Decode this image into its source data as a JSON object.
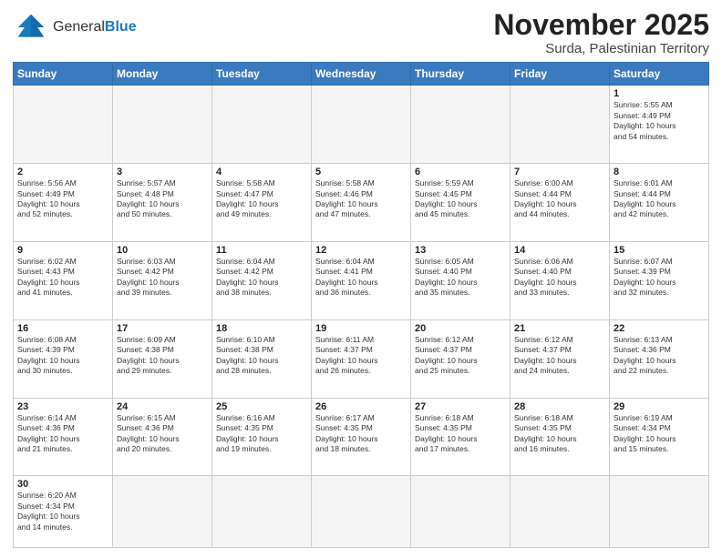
{
  "header": {
    "logo_general": "General",
    "logo_blue": "Blue",
    "month_year": "November 2025",
    "location": "Surda, Palestinian Territory"
  },
  "days_of_week": [
    "Sunday",
    "Monday",
    "Tuesday",
    "Wednesday",
    "Thursday",
    "Friday",
    "Saturday"
  ],
  "weeks": [
    [
      {
        "day": "",
        "info": ""
      },
      {
        "day": "",
        "info": ""
      },
      {
        "day": "",
        "info": ""
      },
      {
        "day": "",
        "info": ""
      },
      {
        "day": "",
        "info": ""
      },
      {
        "day": "",
        "info": ""
      },
      {
        "day": "1",
        "info": "Sunrise: 5:55 AM\nSunset: 4:49 PM\nDaylight: 10 hours\nand 54 minutes."
      }
    ],
    [
      {
        "day": "2",
        "info": "Sunrise: 5:56 AM\nSunset: 4:49 PM\nDaylight: 10 hours\nand 52 minutes."
      },
      {
        "day": "3",
        "info": "Sunrise: 5:57 AM\nSunset: 4:48 PM\nDaylight: 10 hours\nand 50 minutes."
      },
      {
        "day": "4",
        "info": "Sunrise: 5:58 AM\nSunset: 4:47 PM\nDaylight: 10 hours\nand 49 minutes."
      },
      {
        "day": "5",
        "info": "Sunrise: 5:58 AM\nSunset: 4:46 PM\nDaylight: 10 hours\nand 47 minutes."
      },
      {
        "day": "6",
        "info": "Sunrise: 5:59 AM\nSunset: 4:45 PM\nDaylight: 10 hours\nand 45 minutes."
      },
      {
        "day": "7",
        "info": "Sunrise: 6:00 AM\nSunset: 4:44 PM\nDaylight: 10 hours\nand 44 minutes."
      },
      {
        "day": "8",
        "info": "Sunrise: 6:01 AM\nSunset: 4:44 PM\nDaylight: 10 hours\nand 42 minutes."
      }
    ],
    [
      {
        "day": "9",
        "info": "Sunrise: 6:02 AM\nSunset: 4:43 PM\nDaylight: 10 hours\nand 41 minutes."
      },
      {
        "day": "10",
        "info": "Sunrise: 6:03 AM\nSunset: 4:42 PM\nDaylight: 10 hours\nand 39 minutes."
      },
      {
        "day": "11",
        "info": "Sunrise: 6:04 AM\nSunset: 4:42 PM\nDaylight: 10 hours\nand 38 minutes."
      },
      {
        "day": "12",
        "info": "Sunrise: 6:04 AM\nSunset: 4:41 PM\nDaylight: 10 hours\nand 36 minutes."
      },
      {
        "day": "13",
        "info": "Sunrise: 6:05 AM\nSunset: 4:40 PM\nDaylight: 10 hours\nand 35 minutes."
      },
      {
        "day": "14",
        "info": "Sunrise: 6:06 AM\nSunset: 4:40 PM\nDaylight: 10 hours\nand 33 minutes."
      },
      {
        "day": "15",
        "info": "Sunrise: 6:07 AM\nSunset: 4:39 PM\nDaylight: 10 hours\nand 32 minutes."
      }
    ],
    [
      {
        "day": "16",
        "info": "Sunrise: 6:08 AM\nSunset: 4:39 PM\nDaylight: 10 hours\nand 30 minutes."
      },
      {
        "day": "17",
        "info": "Sunrise: 6:09 AM\nSunset: 4:38 PM\nDaylight: 10 hours\nand 29 minutes."
      },
      {
        "day": "18",
        "info": "Sunrise: 6:10 AM\nSunset: 4:38 PM\nDaylight: 10 hours\nand 28 minutes."
      },
      {
        "day": "19",
        "info": "Sunrise: 6:11 AM\nSunset: 4:37 PM\nDaylight: 10 hours\nand 26 minutes."
      },
      {
        "day": "20",
        "info": "Sunrise: 6:12 AM\nSunset: 4:37 PM\nDaylight: 10 hours\nand 25 minutes."
      },
      {
        "day": "21",
        "info": "Sunrise: 6:12 AM\nSunset: 4:37 PM\nDaylight: 10 hours\nand 24 minutes."
      },
      {
        "day": "22",
        "info": "Sunrise: 6:13 AM\nSunset: 4:36 PM\nDaylight: 10 hours\nand 22 minutes."
      }
    ],
    [
      {
        "day": "23",
        "info": "Sunrise: 6:14 AM\nSunset: 4:36 PM\nDaylight: 10 hours\nand 21 minutes."
      },
      {
        "day": "24",
        "info": "Sunrise: 6:15 AM\nSunset: 4:36 PM\nDaylight: 10 hours\nand 20 minutes."
      },
      {
        "day": "25",
        "info": "Sunrise: 6:16 AM\nSunset: 4:35 PM\nDaylight: 10 hours\nand 19 minutes."
      },
      {
        "day": "26",
        "info": "Sunrise: 6:17 AM\nSunset: 4:35 PM\nDaylight: 10 hours\nand 18 minutes."
      },
      {
        "day": "27",
        "info": "Sunrise: 6:18 AM\nSunset: 4:35 PM\nDaylight: 10 hours\nand 17 minutes."
      },
      {
        "day": "28",
        "info": "Sunrise: 6:18 AM\nSunset: 4:35 PM\nDaylight: 10 hours\nand 16 minutes."
      },
      {
        "day": "29",
        "info": "Sunrise: 6:19 AM\nSunset: 4:34 PM\nDaylight: 10 hours\nand 15 minutes."
      }
    ],
    [
      {
        "day": "30",
        "info": "Sunrise: 6:20 AM\nSunset: 4:34 PM\nDaylight: 10 hours\nand 14 minutes."
      },
      {
        "day": "",
        "info": ""
      },
      {
        "day": "",
        "info": ""
      },
      {
        "day": "",
        "info": ""
      },
      {
        "day": "",
        "info": ""
      },
      {
        "day": "",
        "info": ""
      },
      {
        "day": "",
        "info": ""
      }
    ]
  ]
}
